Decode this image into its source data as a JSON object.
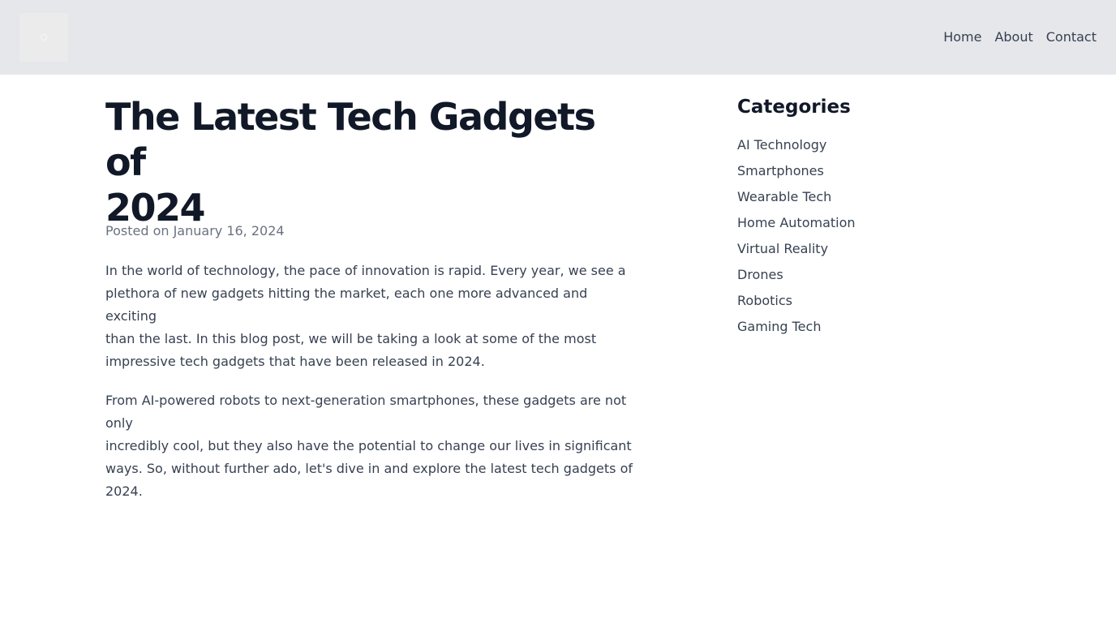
{
  "header": {
    "logo_icon": "logo-placeholder-icon",
    "nav": [
      {
        "label": "Home"
      },
      {
        "label": "About"
      },
      {
        "label": "Contact"
      }
    ],
    "background": "#e5e7eb"
  },
  "article": {
    "title": "The Latest Tech Gadgets of\n2024",
    "date": "Posted on January 16, 2024",
    "paragraphs": [
      "In the world of technology, the pace of innovation is rapid. Every year, we see a\nplethora of new gadgets hitting the market, each one more advanced and exciting\nthan the last. In this blog post, we will be taking a look at some of the most\nimpressive tech gadgets that have been released in 2024.",
      "From AI-powered robots to next-generation smartphones, these gadgets are not only\nincredibly cool, but they also have the potential to change our lives in significant\nways. So, without further ado, let's dive in and explore the latest tech gadgets of\n2024."
    ]
  },
  "sidebar": {
    "title": "Categories",
    "categories": [
      {
        "label": "AI Technology"
      },
      {
        "label": "Smartphones"
      },
      {
        "label": "Wearable Tech"
      },
      {
        "label": "Home Automation"
      },
      {
        "label": "Virtual Reality"
      },
      {
        "label": "Drones"
      },
      {
        "label": "Robotics"
      },
      {
        "label": "Gaming Tech"
      }
    ]
  }
}
